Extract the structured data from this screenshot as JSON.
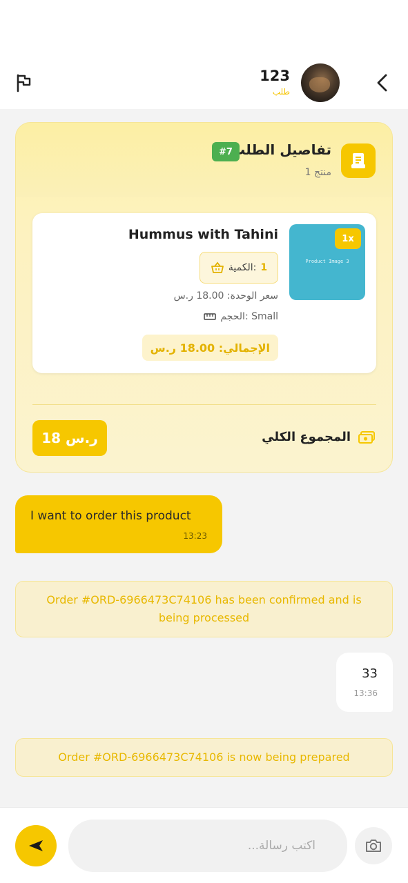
{
  "header": {
    "title": "123",
    "subtitle": "طلب"
  },
  "order": {
    "title": "تفاصيل الطلب",
    "badge": "#7",
    "count": "1 منتج",
    "product": {
      "image_label": "Product Image 3",
      "qty_tag": "1x",
      "name": "Hummus with Tahini",
      "qty_label": "الكمية:",
      "qty_value": "1",
      "unit_price": "سعر الوحدة: 18.00 ر.س",
      "size": "الحجم: Small",
      "total": "الإجمالي: 18.00 ر.س"
    },
    "grand_total_label": "المجموع الكلي",
    "grand_total_value": "18 ر.س"
  },
  "messages": {
    "outgoing": {
      "text": "I want to order this product",
      "time": "13:23"
    },
    "system_1": "Order #ORD-6966473C74106 has been confirmed and is being processed",
    "incoming": {
      "text": "33",
      "time": "13:36"
    },
    "system_2": "Order #ORD-6966473C74106 is now being prepared"
  },
  "composer": {
    "placeholder": "اكتب رسالة..."
  },
  "icons": {
    "flag": "flag-icon",
    "back": "chevron-left-icon",
    "receipt": "receipt-icon",
    "basket": "basket-icon",
    "ruler": "ruler-icon",
    "money": "money-icon",
    "send": "send-icon",
    "camera": "camera-icon"
  },
  "colors": {
    "accent": "#f6c700",
    "badge_green": "#4caf50",
    "system_text": "#e8b800"
  }
}
